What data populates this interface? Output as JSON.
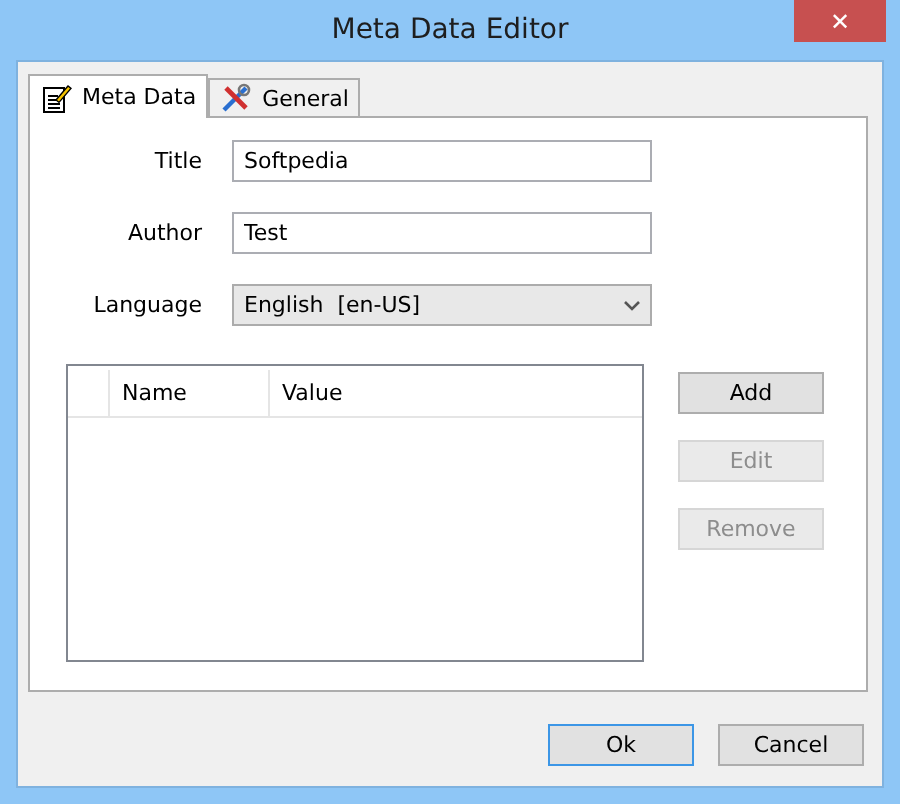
{
  "window": {
    "title": "Meta Data Editor",
    "close": "✕"
  },
  "tabs": [
    {
      "label": "Meta Data",
      "kind": "note",
      "selected": true
    },
    {
      "label": "General",
      "kind": "tools",
      "selected": false
    }
  ],
  "fields": [
    {
      "kind": "text",
      "label": "Title",
      "value": "Softpedia"
    },
    {
      "kind": "text",
      "label": "Author",
      "value": "Test"
    },
    {
      "kind": "select",
      "label": "Language",
      "value": "English  [en-US]"
    }
  ],
  "table": {
    "columns": [
      "Name",
      "Value"
    ]
  },
  "side_buttons": [
    {
      "label": "Add",
      "disabled": false
    },
    {
      "label": "Edit",
      "disabled": true
    },
    {
      "label": "Remove",
      "disabled": true
    }
  ],
  "buttons": [
    {
      "label": "Ok",
      "default": true
    },
    {
      "label": "Cancel",
      "default": false
    }
  ]
}
